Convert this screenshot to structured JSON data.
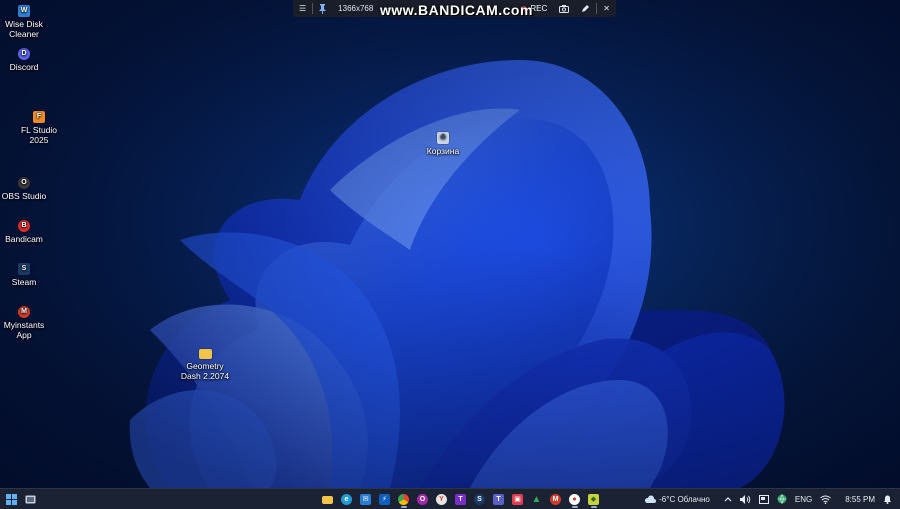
{
  "bandicam": {
    "menu_icon": "☰",
    "resolution": "1366x768",
    "logo": "www.BANDICAM.com",
    "rec_label": "REC",
    "close_icon": "✕"
  },
  "desktop_icons": [
    {
      "label": "Wise Disk\nCleaner",
      "icon": "wise-disk-cleaner-icon",
      "color": "#2f7fd6",
      "glyph": "W"
    },
    {
      "label": "Discord",
      "icon": "discord-icon",
      "color": "#5865f2",
      "glyph": "D"
    },
    {
      "label": "FL Studio\n2025",
      "icon": "fl-studio-icon",
      "color": "#f08a24",
      "glyph": "F"
    },
    {
      "label": "OBS Studio",
      "icon": "obs-studio-icon",
      "color": "#3a3a3a",
      "glyph": "O"
    },
    {
      "label": "Bandicam",
      "icon": "bandicam-icon",
      "color": "#d9302c",
      "glyph": "B"
    },
    {
      "label": "Steam",
      "icon": "steam-icon",
      "color": "#1b3a66",
      "glyph": "S"
    },
    {
      "label": "Myinstants\nApp",
      "icon": "myinstants-icon",
      "color": "#d23c2a",
      "glyph": "M"
    },
    {
      "label": "Корзина",
      "icon": "recycle-bin-icon",
      "color": "#c9d4e4",
      "glyph": "♻"
    },
    {
      "label": "Geometry\nDash 2.2074",
      "icon": "folder-icon",
      "color": "#f2c44a",
      "glyph": ""
    }
  ],
  "taskbar": {
    "weather": "-6°C Облачно",
    "language": "ENG",
    "time": "8:55 PM",
    "tray_chevron": "^",
    "apps": [
      {
        "name": "file-explorer-icon",
        "color": "#f2c44a",
        "glyph": ""
      },
      {
        "name": "edge-icon",
        "color": "#1f9bd6",
        "glyph": "e"
      },
      {
        "name": "mail-icon",
        "color": "#2b7cd3",
        "glyph": "✉"
      },
      {
        "name": "power-automate-icon",
        "color": "#0f5fbf",
        "glyph": "⚡"
      },
      {
        "name": "chrome-icon",
        "color": "#e9b92b",
        "glyph": "●"
      },
      {
        "name": "opera-icon",
        "color": "#a22aa8",
        "glyph": "O"
      },
      {
        "name": "yandex-browser-icon",
        "color": "#e6e6e6",
        "glyph": "Y"
      },
      {
        "name": "tor-browser-icon",
        "color": "#7a2ec7",
        "glyph": "T"
      },
      {
        "name": "steam-taskbar-icon",
        "color": "#1b3a66",
        "glyph": "S"
      },
      {
        "name": "teams-icon",
        "color": "#5b5fc7",
        "glyph": "T"
      },
      {
        "name": "store-icon",
        "color": "#e23c4f",
        "glyph": "▣"
      },
      {
        "name": "google-drive-icon",
        "color": "#34a853",
        "glyph": "▲"
      },
      {
        "name": "myinstants-taskbar-icon",
        "color": "#d23c2a",
        "glyph": "M"
      },
      {
        "name": "bandicam-taskbar-icon",
        "color": "#d9302c",
        "glyph": "●"
      },
      {
        "name": "geometry-dash-icon",
        "color": "#c8d23a",
        "glyph": "◆"
      }
    ]
  }
}
